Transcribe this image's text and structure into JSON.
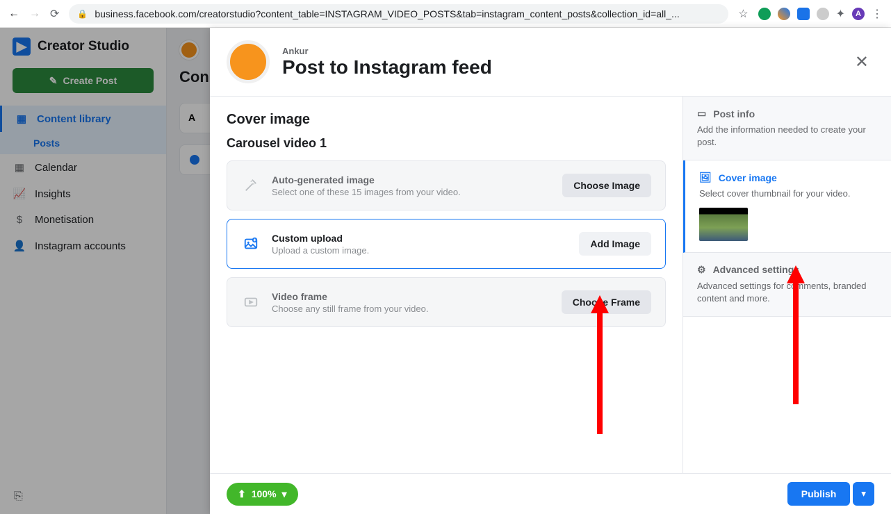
{
  "browser": {
    "url": "business.facebook.com/creatorstudio?content_table=INSTAGRAM_VIDEO_POSTS&tab=instagram_content_posts&collection_id=all_..."
  },
  "app": {
    "brand": "Creator Studio",
    "create_button": "Create Post",
    "nav": {
      "content_library": "Content library",
      "posts": "Posts",
      "calendar": "Calendar",
      "insights": "Insights",
      "monetisation": "Monetisation",
      "instagram_accounts": "Instagram accounts"
    },
    "bg_heading": "Con"
  },
  "modal": {
    "user": "Ankur",
    "title": "Post to Instagram feed",
    "section_title": "Cover image",
    "section_sub": "Carousel video 1",
    "options": {
      "auto": {
        "title": "Auto-generated image",
        "desc": "Select one of these 15 images from your video.",
        "button": "Choose Image"
      },
      "custom": {
        "title": "Custom upload",
        "desc": "Upload a custom image.",
        "button": "Add Image"
      },
      "frame": {
        "title": "Video frame",
        "desc": "Choose any still frame from your video.",
        "button": "Choose Frame"
      }
    },
    "side": {
      "post_info": {
        "title": "Post info",
        "desc": "Add the information needed to create your post."
      },
      "cover": {
        "title": "Cover image",
        "desc": "Select cover thumbnail for your video."
      },
      "advanced": {
        "title": "Advanced settings",
        "desc": "Advanced settings for comments, branded content and more."
      }
    },
    "footer": {
      "progress": "100%",
      "publish": "Publish"
    }
  }
}
